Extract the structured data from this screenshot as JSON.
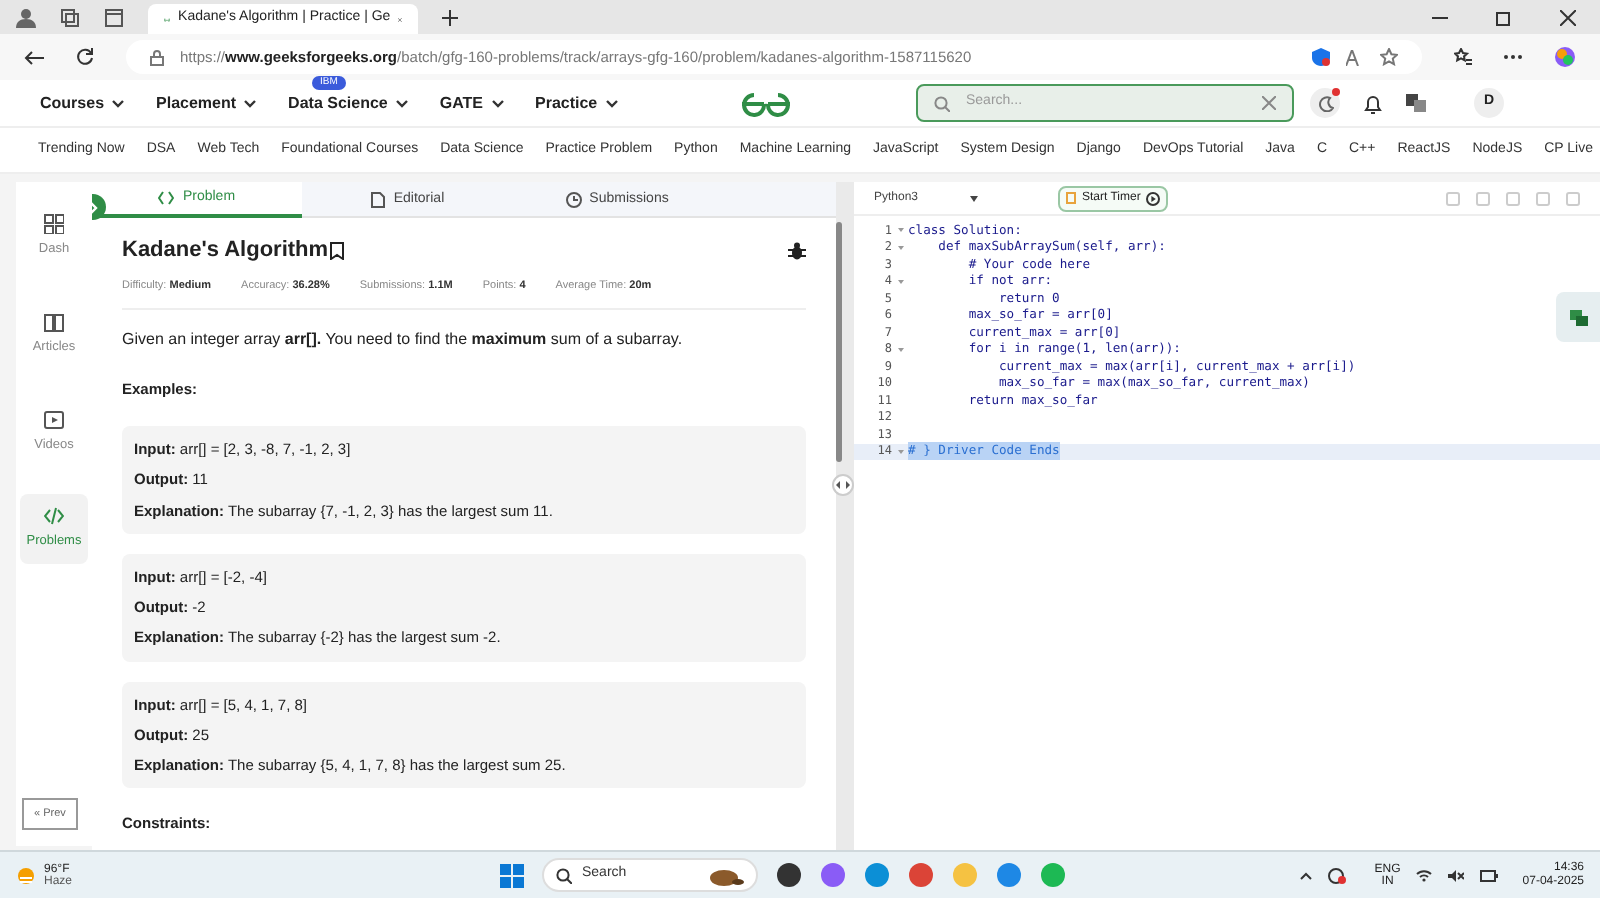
{
  "browser": {
    "tab_title": "Kadane's Algorithm | Practice | Ge",
    "url": "https://**www.geeksforgeeks.org**/batch/gfg-160-problems/track/arrays-gfg-160/problem/kadanes-algorithm-1587115620"
  },
  "site_nav": [
    {
      "label": "Courses"
    },
    {
      "label": "Placement"
    },
    {
      "label": "Data Science",
      "badge": "IBM"
    },
    {
      "label": "GATE"
    },
    {
      "label": "Practice"
    }
  ],
  "search": {
    "placeholder": "Search..."
  },
  "avatar": "D",
  "topics": [
    "Trending Now",
    "DSA",
    "Web Tech",
    "Foundational Courses",
    "Data Science",
    "Practice Problem",
    "Python",
    "Machine Learning",
    "JavaScript",
    "System Design",
    "Django",
    "DevOps Tutorial",
    "Java",
    "C",
    "C++",
    "ReactJS",
    "NodeJS",
    "CP Live"
  ],
  "side_nav": [
    {
      "label": "Dash",
      "selected": false
    },
    {
      "label": "Articles",
      "selected": false
    },
    {
      "label": "Videos",
      "selected": false
    },
    {
      "label": "Problems",
      "selected": true
    }
  ],
  "prev_button": "« Prev",
  "problem_tabs": [
    {
      "label": "Problem",
      "selected": true
    },
    {
      "label": "Editorial",
      "selected": false
    },
    {
      "label": "Submissions",
      "selected": false
    }
  ],
  "problem": {
    "title": "Kadane's Algorithm",
    "meta": [
      {
        "label": "Difficulty:",
        "value": "Medium"
      },
      {
        "label": "Accuracy:",
        "value": "36.28%"
      },
      {
        "label": "Submissions:",
        "value": "1.1M"
      },
      {
        "label": "Points:",
        "value": "4"
      },
      {
        "label": "Average Time:",
        "value": "20m"
      }
    ],
    "description": "Given an integer array **arr[].** You need to find the **maximum** sum of a subarray.",
    "examples_heading": "Examples:",
    "examples": [
      {
        "input": "**Input:** arr[] = [2, 3, -8, 7, -1, 2, 3]",
        "output": "**Output:** 11",
        "explanation": "**Explanation:** The subarray {7, -1, 2, 3} has the largest sum 11."
      },
      {
        "input": "**Input:** arr[] = [-2, -4]",
        "output": "**Output:** -2",
        "explanation": "**Explanation:** The subarray {-2} has the largest sum -2."
      },
      {
        "input": "**Input:** arr[] = [5, 4, 1, 7, 8]",
        "output": "**Output:** 25",
        "explanation": "**Explanation:** The subarray {5, 4, 1, 7, 8} has the largest sum 25."
      }
    ],
    "constraints_heading": "Constraints:"
  },
  "editor": {
    "language": "Python3",
    "timer": "Start Timer",
    "lines": [
      {
        "number": "1",
        "text": "class Solution:",
        "foldable": true,
        "selected": false
      },
      {
        "number": "2",
        "text": "    def maxSubArraySum(self, arr):",
        "foldable": true,
        "selected": false
      },
      {
        "number": "3",
        "text": "        # Your code here",
        "foldable": false,
        "selected": false
      },
      {
        "number": "4",
        "text": "        if not arr:",
        "foldable": true,
        "selected": false
      },
      {
        "number": "5",
        "text": "            return 0",
        "foldable": false,
        "selected": false
      },
      {
        "number": "6",
        "text": "        max_so_far = arr[0]",
        "foldable": false,
        "selected": false
      },
      {
        "number": "7",
        "text": "        current_max = arr[0]",
        "foldable": false,
        "selected": false
      },
      {
        "number": "8",
        "text": "        for i in range(1, len(arr)):",
        "foldable": true,
        "selected": false
      },
      {
        "number": "9",
        "text": "            current_max = max(arr[i], current_max + arr[i])",
        "foldable": false,
        "selected": false
      },
      {
        "number": "10",
        "text": "            max_so_far = max(max_so_far, current_max)",
        "foldable": false,
        "selected": false
      },
      {
        "number": "11",
        "text": "        return max_so_far",
        "foldable": false,
        "selected": false
      },
      {
        "number": "12",
        "foldable": false,
        "selected": false
      },
      {
        "number": "13",
        "foldable": false,
        "selected": false
      },
      {
        "number": "14",
        "text": "# } Driver Code Ends",
        "foldable": true,
        "selected": true
      }
    ]
  },
  "taskbar": {
    "temperature": "96°F",
    "weather": "Haze",
    "search": "Search",
    "language": "ENG",
    "region": "IN",
    "time": "14:36",
    "date": "07-04-2025"
  }
}
